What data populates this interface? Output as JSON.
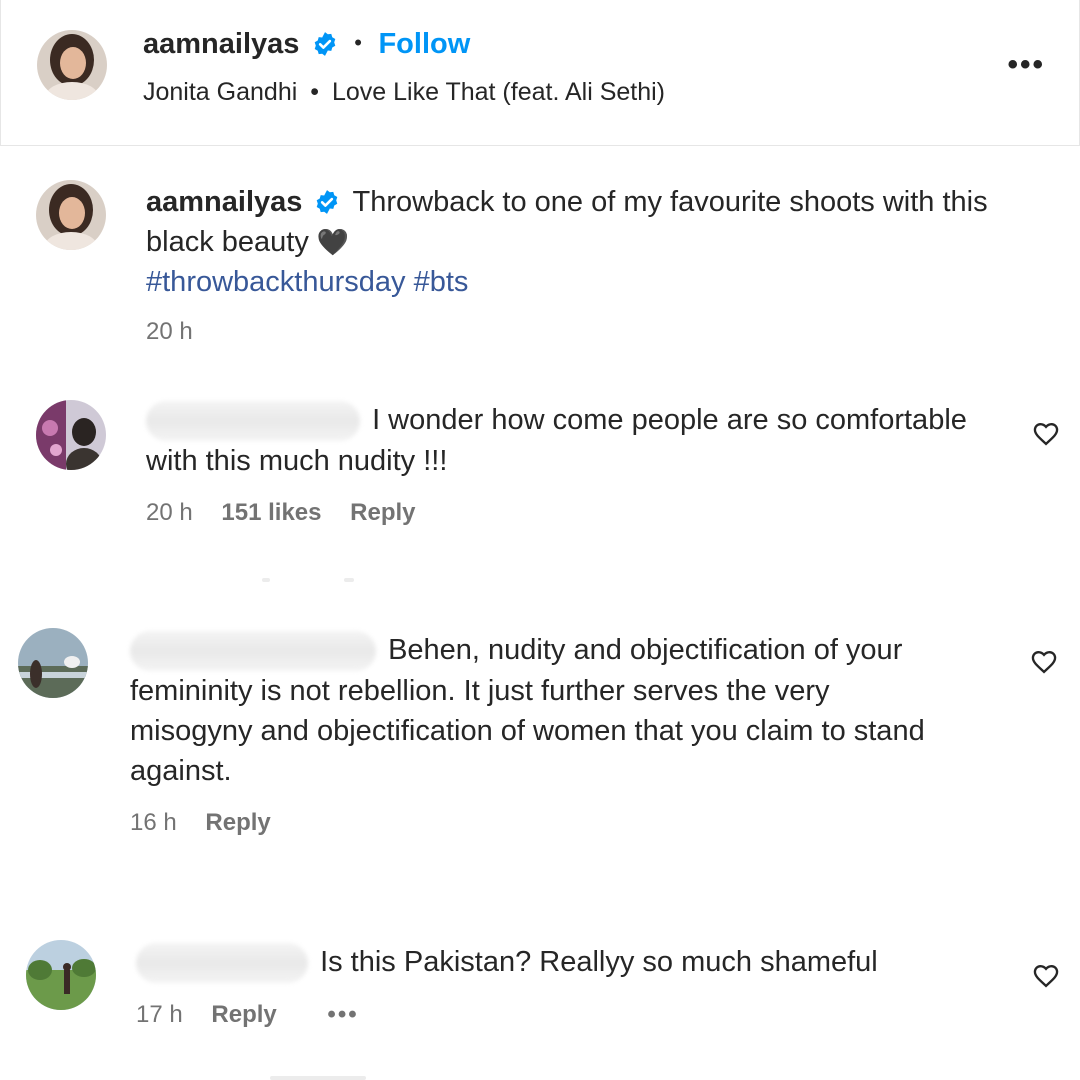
{
  "post_header": {
    "username": "aamnailyas",
    "separator": "•",
    "follow_label": "Follow",
    "audio_artist": "Jonita Gandhi",
    "audio_separator": "•",
    "audio_track": "Love Like That (feat. Ali Sethi)",
    "more_label": "•••"
  },
  "caption": {
    "username": "aamnailyas",
    "text_line1": "Throwback to one of my favourite shoots with this",
    "text_line2": "black beauty",
    "emoji": "🖤",
    "hashtags": "#throwbackthursday #bts",
    "time": "20 h"
  },
  "comments": [
    {
      "text_line1": "I wonder how come people are so comfortable",
      "text_line2": "with this much nudity !!!",
      "time": "20 h",
      "likes": "151 likes",
      "reply": "Reply"
    },
    {
      "text_line1": "Behen, nudity and objectification of your",
      "text_line2": "femininity is not rebellion. It just further serves the very",
      "text_line3": "misogyny and objectification of women that you claim to stand",
      "text_line4": "against.",
      "time": "16 h",
      "reply": "Reply"
    },
    {
      "text_line1": "Is this Pakistan? Reallyy so much shameful",
      "time": "17 h",
      "reply": "Reply",
      "more": "•••"
    }
  ],
  "icons": {
    "verified": "verified-badge-icon",
    "heart": "heart-outline-icon",
    "more": "more-horizontal-icon"
  },
  "colors": {
    "follow_blue": "#0095f6",
    "hashtag_blue": "#385898",
    "verified_blue": "#0095f6",
    "meta_gray": "#737373"
  }
}
